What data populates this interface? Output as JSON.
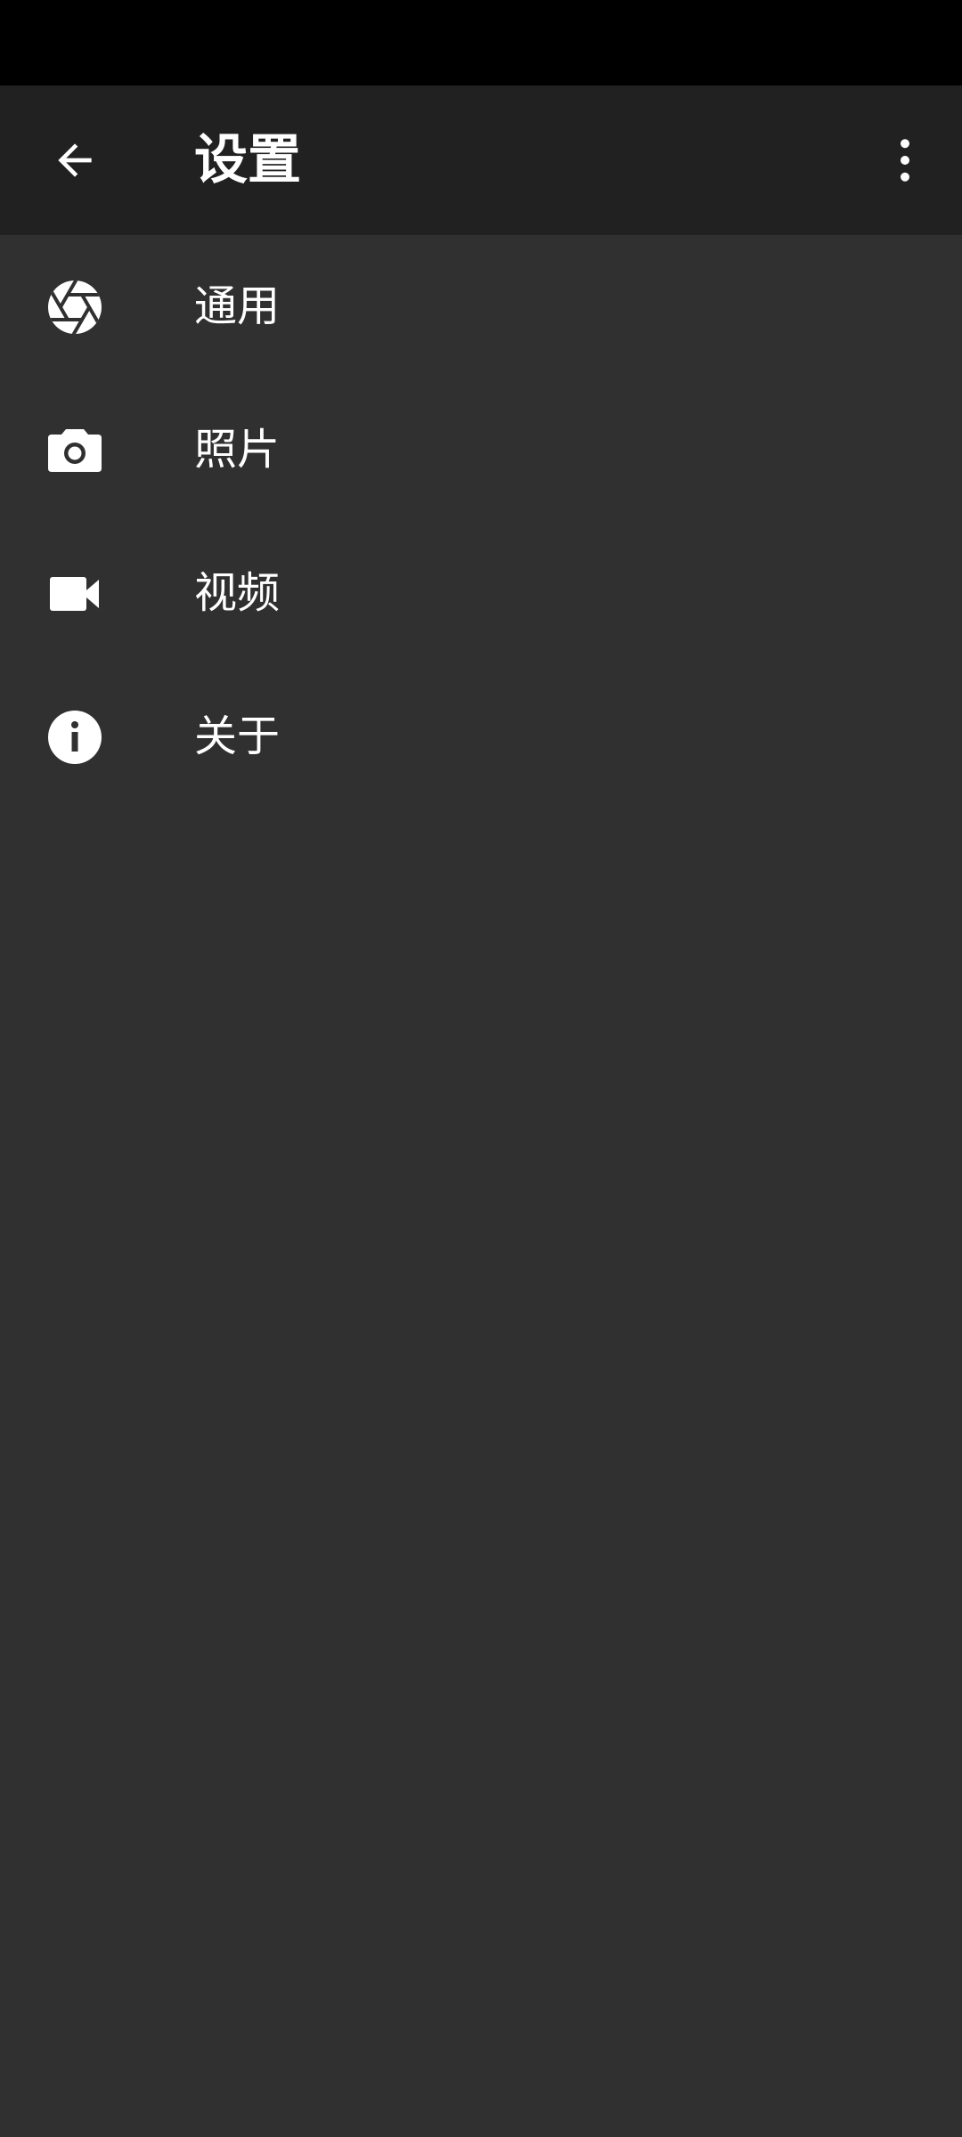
{
  "app_bar": {
    "title": "设置",
    "back_icon": "arrow-back-icon",
    "overflow_icon": "more-vert-icon"
  },
  "settings": {
    "items": [
      {
        "label": "通用",
        "icon": "aperture-icon"
      },
      {
        "label": "照片",
        "icon": "camera-icon"
      },
      {
        "label": "视频",
        "icon": "videocam-icon"
      },
      {
        "label": "关于",
        "icon": "info-icon"
      }
    ]
  },
  "colors": {
    "status_bar": "#000000",
    "app_bar": "#212121",
    "background": "#303030",
    "foreground": "#ffffff"
  }
}
